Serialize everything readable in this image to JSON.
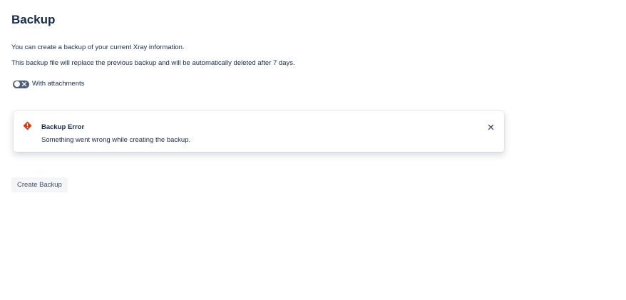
{
  "header": {
    "title": "Backup"
  },
  "description": {
    "line1": "You can create a backup of your current Xray information.",
    "line2": "This backup file will replace the previous backup and will be automatically deleted after 7 days."
  },
  "attachments_toggle": {
    "label": "With attachments",
    "checked": false
  },
  "error_flag": {
    "icon": "error-icon",
    "title": "Backup Error",
    "message": "Something went wrong while creating the backup.",
    "close_icon": "close-icon",
    "accent_color": "#de350b"
  },
  "actions": {
    "create_backup_label": "Create Backup"
  }
}
